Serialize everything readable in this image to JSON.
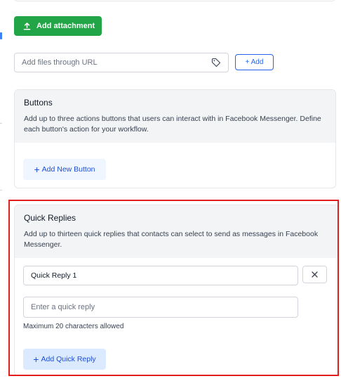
{
  "attachment": {
    "button_label": "Add attachment",
    "upload_icon": "upload-icon"
  },
  "url_input": {
    "placeholder": "Add files through URL",
    "value": "",
    "tag_icon": "tag-icon",
    "add_label": "+ Add"
  },
  "buttons_section": {
    "title": "Buttons",
    "description": "Add up to three actions buttons that users can interact with in Facebook Messenger. Define each button's action for your workflow.",
    "add_button_label": "Add New Button",
    "plus_icon": "+"
  },
  "quick_replies_section": {
    "title": "Quick Replies",
    "description": "Add up to thirteen quick replies that contacts can select to send as messages in Facebook Messenger.",
    "replies": [
      {
        "value": "Quick Reply 1"
      }
    ],
    "new_reply_placeholder": "Enter a quick reply",
    "helper_text": "Maximum 20 characters allowed",
    "add_button_label": "Add Quick Reply",
    "plus_icon": "+",
    "remove_icon": "close-icon"
  },
  "colors": {
    "primary_green": "#22a546",
    "link_blue": "#2563eb",
    "highlight_red": "#e11d1d",
    "section_header_bg": "#f3f4f6"
  }
}
